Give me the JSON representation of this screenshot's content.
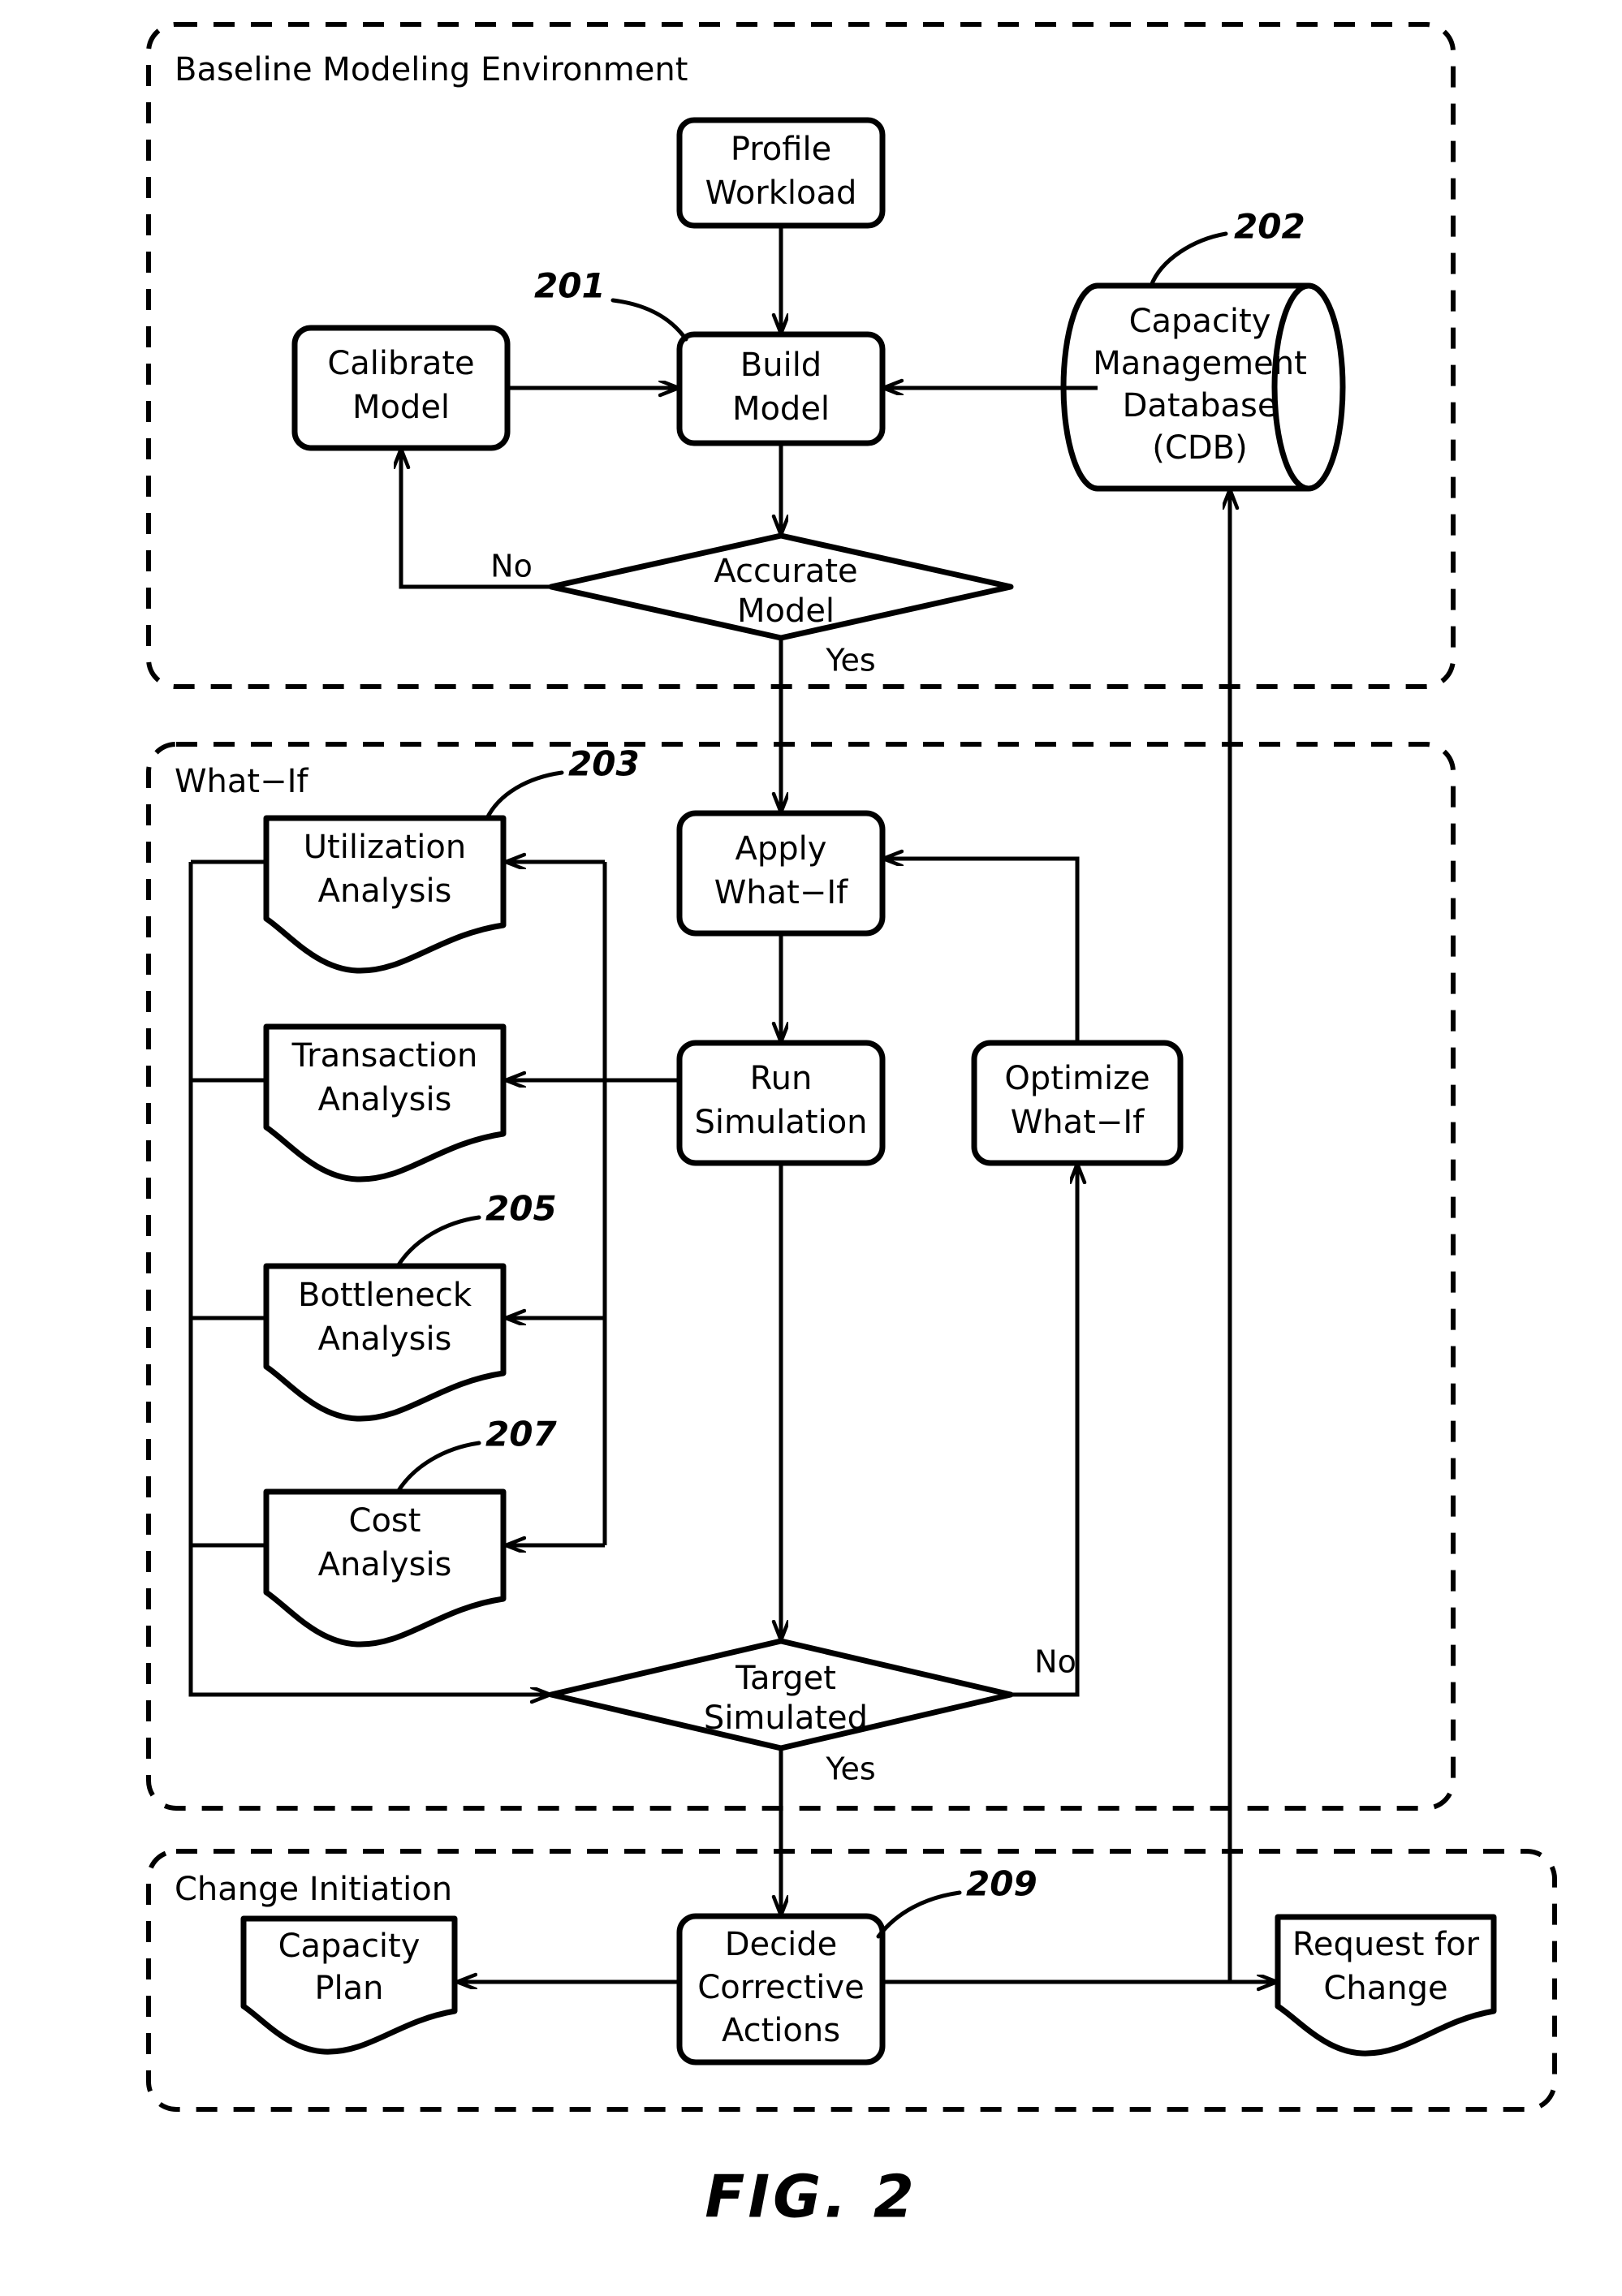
{
  "figure": {
    "caption": "FIG. 2"
  },
  "panels": [
    {
      "id": "baseline",
      "title": "Baseline Modeling Environment"
    },
    {
      "id": "whatif",
      "title": "What−If"
    },
    {
      "id": "change",
      "title": "Change Initiation"
    }
  ],
  "nodes": {
    "profile_workload": {
      "label_line1": "Profile",
      "label_line2": "Workload"
    },
    "build_model": {
      "label_line1": "Build",
      "label_line2": "Model"
    },
    "calibrate_model": {
      "label_line1": "Calibrate",
      "label_line2": "Model"
    },
    "cdb": {
      "label_line1": "Capacity",
      "label_line2": "Management",
      "label_line3": "Database",
      "label_line4": "(CDB)"
    },
    "accurate_model": {
      "label_line1": "Accurate",
      "label_line2": "Model"
    },
    "apply_whatif": {
      "label_line1": "Apply",
      "label_line2": "What−If"
    },
    "run_simulation": {
      "label_line1": "Run",
      "label_line2": "Simulation"
    },
    "optimize_whatif": {
      "label_line1": "Optimize",
      "label_line2": "What−If"
    },
    "utilization_analysis": {
      "label_line1": "Utilization",
      "label_line2": "Analysis"
    },
    "transaction_analysis": {
      "label_line1": "Transaction",
      "label_line2": "Analysis"
    },
    "bottleneck_analysis": {
      "label_line1": "Bottleneck",
      "label_line2": "Analysis"
    },
    "cost_analysis": {
      "label_line1": "Cost",
      "label_line2": "Analysis"
    },
    "target_simulated": {
      "label_line1": "Target",
      "label_line2": "Simulated"
    },
    "decide_corrective": {
      "label_line1": "Decide",
      "label_line2": "Corrective",
      "label_line3": "Actions"
    },
    "capacity_plan": {
      "label_line1": "Capacity",
      "label_line2": "Plan"
    },
    "request_for_change": {
      "label_line1": "Request for",
      "label_line2": "Change"
    }
  },
  "edge_labels": {
    "accurate_no": "No",
    "accurate_yes": "Yes",
    "target_no": "No",
    "target_yes": "Yes"
  },
  "reference_numerals": {
    "build_model": "201",
    "cdb": "202",
    "utilization_analysis": "203",
    "bottleneck_analysis": "205",
    "cost_analysis": "207",
    "decide_corrective": "209"
  },
  "colors": {
    "ink": "#000000",
    "paper": "#ffffff"
  }
}
